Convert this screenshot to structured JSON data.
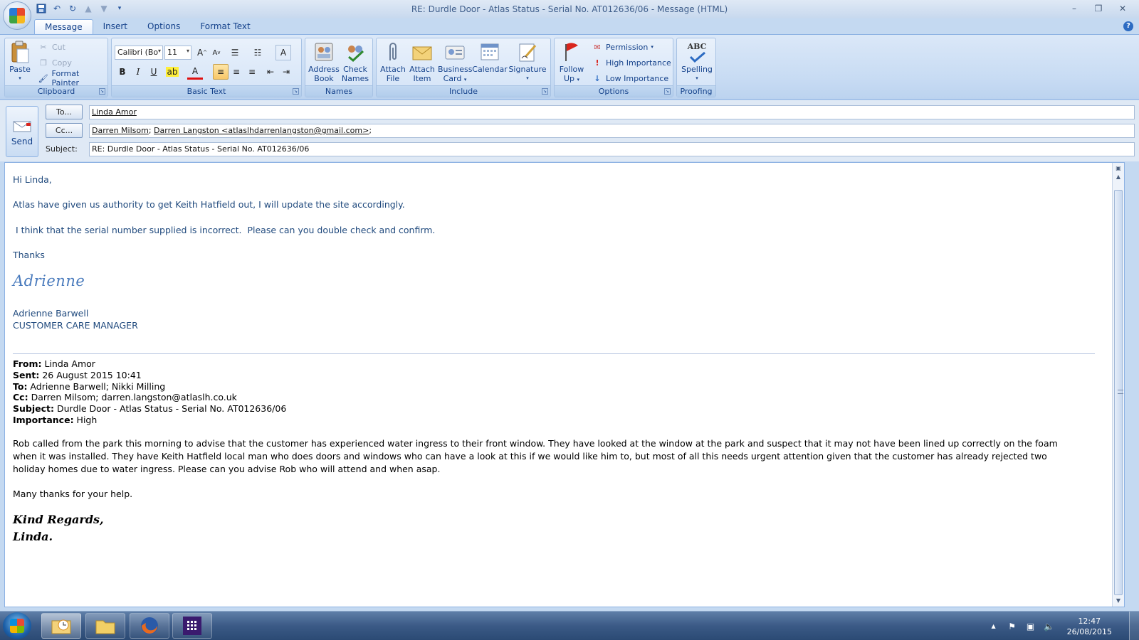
{
  "window": {
    "title": "RE: Durdle Door - Atlas Status - Serial No. AT012636/06 - Message (HTML)"
  },
  "ribbon": {
    "tabs": [
      "Message",
      "Insert",
      "Options",
      "Format Text"
    ],
    "active_tab": "Message",
    "groups": {
      "clipboard": {
        "label": "Clipboard",
        "paste": "Paste",
        "cut": "Cut",
        "copy": "Copy",
        "format_painter": "Format Painter"
      },
      "basic_text": {
        "label": "Basic Text",
        "font": "Calibri (Bo",
        "size": "11"
      },
      "names": {
        "label": "Names",
        "address_book_1": "Address",
        "address_book_2": "Book",
        "check_names_1": "Check",
        "check_names_2": "Names"
      },
      "include": {
        "label": "Include",
        "attach_file_1": "Attach",
        "attach_file_2": "File",
        "attach_item_1": "Attach",
        "attach_item_2": "Item",
        "business_card_1": "Business",
        "business_card_2": "Card",
        "calendar": "Calendar",
        "signature": "Signature"
      },
      "options": {
        "label": "Options",
        "follow_up_1": "Follow",
        "follow_up_2": "Up",
        "permission": "Permission",
        "high_importance": "High Importance",
        "low_importance": "Low Importance"
      },
      "proofing": {
        "label": "Proofing",
        "spelling": "Spelling",
        "abc": "ABC"
      }
    }
  },
  "header": {
    "send": "Send",
    "to_button": "To...",
    "cc_button": "Cc...",
    "subject_label": "Subject:",
    "to_value": "Linda Amor",
    "cc_value_1": "Darren Milsom",
    "cc_sep": "; ",
    "cc_value_2": "Darren Langston <atlaslhdarrenlangston@gmail.com>",
    "cc_trail": ";",
    "subject_value": "RE: Durdle Door - Atlas Status - Serial No. AT012636/06"
  },
  "body": {
    "greeting": "Hi Linda,",
    "line1": "Atlas have given us authority to get Keith Hatfield out, I will update the site accordingly.",
    "line2": " I think that the serial number supplied is incorrect.  Please can you double check and confirm.",
    "thanks": "Thanks",
    "signature_script": "Adrienne",
    "sig_name": "Adrienne Barwell",
    "sig_title": "CUSTOMER CARE MANAGER",
    "quoted": {
      "from_label": "From:",
      "from": " Linda Amor",
      "sent_label": "Sent:",
      "sent": " 26 August 2015 10:41",
      "to_label": "To:",
      "to": " Adrienne Barwell; Nikki Milling",
      "cc_label": "Cc:",
      "cc": " Darren Milsom; darren.langston@atlaslh.co.uk",
      "subject_label": "Subject:",
      "subject": " Durdle Door - Atlas Status - Serial No. AT012636/06",
      "importance_label": "Importance:",
      "importance": " High",
      "paragraph": "Rob called from the park this morning to advise that the customer has experienced water ingress to their front window.  They have looked at the window at the park and suspect that it may not have been lined up correctly on the foam when it was installed.  They have Keith Hatfield local man who does doors and windows who can have a look at this if we would like him to, but most of all this needs urgent attention given that the customer has already rejected two holiday homes due to water ingress.  Please can you advise Rob who will attend and when asap.",
      "many_thanks": "Many thanks for your help.",
      "regards_1": "Kind Regards,",
      "regards_2": "Linda."
    }
  },
  "taskbar": {
    "time": "12:47",
    "date": "26/08/2015"
  }
}
